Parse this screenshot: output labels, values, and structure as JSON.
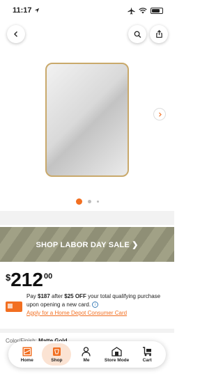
{
  "status_bar": {
    "time": "11:17"
  },
  "product": {
    "image_count": 3,
    "active_image_index": 0
  },
  "banner": {
    "text": "SHOP LABOR DAY SALE ❯"
  },
  "price": {
    "currency": "$",
    "dollars": "212",
    "cents": "00"
  },
  "promo": {
    "pay_prefix": "Pay ",
    "pay_amount": "$187",
    "after_text": " after ",
    "off_amount": "$25 OFF",
    "rest_text": " your total qualifying purchase upon opening a new card.",
    "apply_link": "Apply for a Home Depot Consumer Card"
  },
  "color_finish": {
    "label": "Color/Finish:",
    "value": "Matte Gold"
  },
  "tabs": [
    {
      "label": "Home",
      "icon": "home-depot-logo-icon"
    },
    {
      "label": "Shop",
      "icon": "shop-icon"
    },
    {
      "label": "Me",
      "icon": "person-icon"
    },
    {
      "label": "Store Mode",
      "icon": "store-icon"
    },
    {
      "label": "Cart",
      "icon": "cart-icon"
    }
  ],
  "colors": {
    "accent": "#f26f21",
    "banner": "#969679",
    "frame": "#c9a96b"
  }
}
